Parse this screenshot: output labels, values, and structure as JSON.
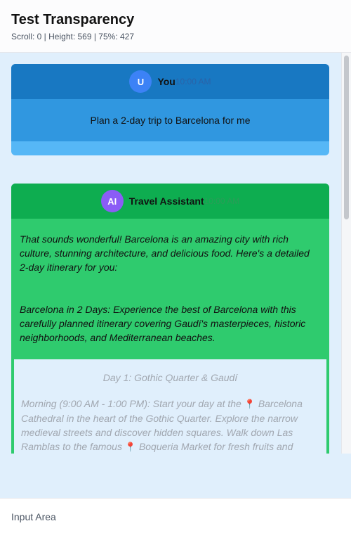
{
  "header": {
    "title": "Test Transparency",
    "stats": "Scroll: 0 | Height: 569 | 75%: 427"
  },
  "messages": {
    "user": {
      "avatar": "U",
      "sender": "You",
      "time": "10:00 AM",
      "text": "Plan a 2-day trip to Barcelona for me"
    },
    "assistant": {
      "avatar": "AI",
      "sender": "Travel Assistant",
      "time": "10:00 AM",
      "intro": "That sounds wonderful! Barcelona is an amazing city with rich culture, stunning architecture, and delicious food. Here's a detailed 2-day itinerary for you:",
      "summary": "Barcelona in 2 Days: Experience the best of Barcelona with this carefully planned itinerary covering Gaudí's masterpieces, historic neighborhoods, and Mediterranean beaches.",
      "day1_title": "Day 1: Gothic Quarter & Gaudí",
      "day1_morning_a": "Morning (9:00 AM - 1:00 PM): Start your day at the",
      "day1_pin1": "📍",
      "day1_morning_b": "Barcelona Cathedral in the heart of the Gothic Quarter. Explore the narrow medieval streets and discover hidden squares. Walk down Las Ramblas to the famous",
      "day1_pin2": "📍",
      "day1_morning_c": "Boqueria Market for fresh fruits and"
    }
  },
  "input": {
    "label": "Input Area"
  }
}
